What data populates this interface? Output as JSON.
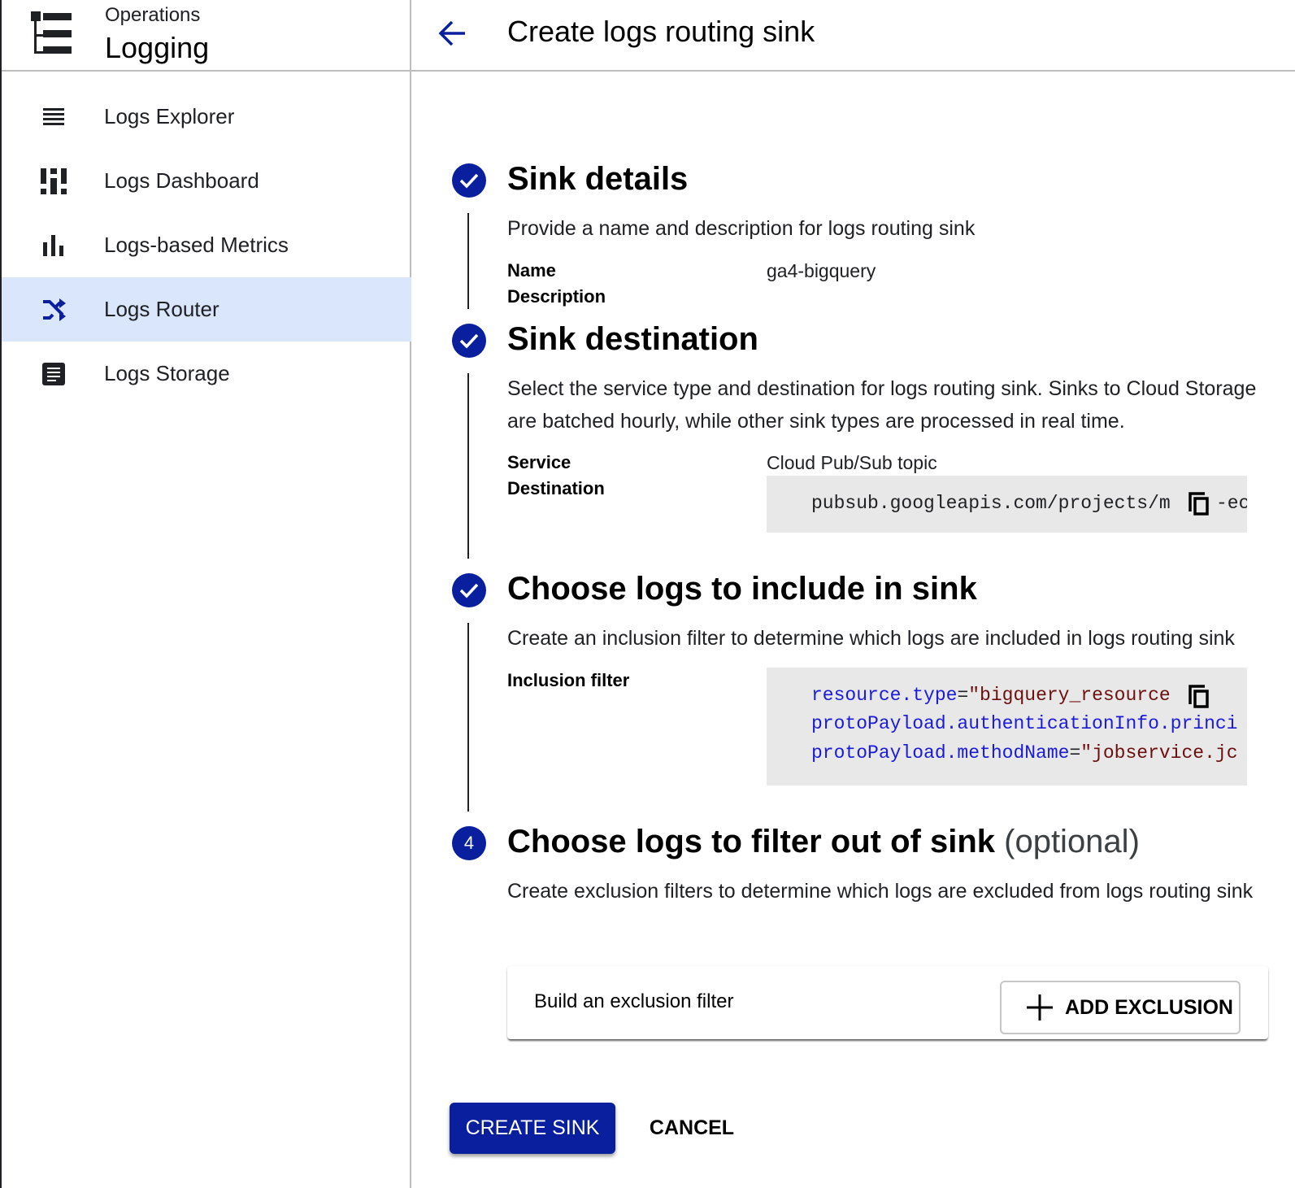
{
  "app": {
    "product_group": "Operations",
    "product_name": "Logging",
    "logo_icon": "logging-tree-icon"
  },
  "sidebar": {
    "items": [
      {
        "label": "Logs Explorer",
        "icon": "list-lines-icon",
        "active": false
      },
      {
        "label": "Logs Dashboard",
        "icon": "dashboard-icon",
        "active": false
      },
      {
        "label": "Logs-based Metrics",
        "icon": "bar-chart-icon",
        "active": false
      },
      {
        "label": "Logs Router",
        "icon": "shuffle-icon",
        "active": true
      },
      {
        "label": "Logs Storage",
        "icon": "storage-document-icon",
        "active": false
      }
    ]
  },
  "header": {
    "back_icon": "arrow-back-icon",
    "title": "Create logs routing sink"
  },
  "steps": [
    {
      "state": "complete",
      "title": "Sink details",
      "description": "Provide a name and description for logs routing sink",
      "fields": [
        {
          "label": "Name",
          "value": "ga4-bigquery"
        },
        {
          "label": "Description",
          "value": ""
        }
      ]
    },
    {
      "state": "complete",
      "title": "Sink destination",
      "description": "Select the service type and destination for logs routing sink. Sinks to Cloud Storage are batched hourly, while other sink types are processed in real time.",
      "fields": [
        {
          "label": "Service",
          "value": "Cloud Pub/Sub topic"
        },
        {
          "label": "Destination",
          "value": "pubsub.googleapis.com/projects/m",
          "value_suffix": "-ec"
        }
      ]
    },
    {
      "state": "complete",
      "title": "Choose logs to include in sink",
      "description": "Create an inclusion filter to determine which logs are included in logs routing sink",
      "fields": [
        {
          "label": "Inclusion filter",
          "code_lines": [
            {
              "key": "resource.type",
              "op": "=",
              "str": "\"bigquery_resource"
            },
            {
              "key": "protoPayload.authenticationInfo.princi",
              "op": "",
              "str": ""
            },
            {
              "key": "protoPayload.methodName",
              "op": "=",
              "str": "\"jobservice.jc"
            }
          ]
        }
      ]
    },
    {
      "state": "current",
      "number": "4",
      "title": "Choose logs to filter out of sink",
      "title_suffix": "(optional)",
      "description": "Create exclusion filters to determine which logs are excluded from logs routing sink",
      "exclusion_card": {
        "text": "Build an exclusion filter",
        "button_label": "ADD EXCLUSION"
      }
    }
  ],
  "actions": {
    "create_label": "CREATE SINK",
    "cancel_label": "CANCEL"
  },
  "colors": {
    "primary": "#0a1f9e",
    "active_nav_bg": "#d9e6fc",
    "code_bg": "#e8e8e8",
    "code_key": "#1a1adb",
    "code_string": "#6b0f0f"
  }
}
